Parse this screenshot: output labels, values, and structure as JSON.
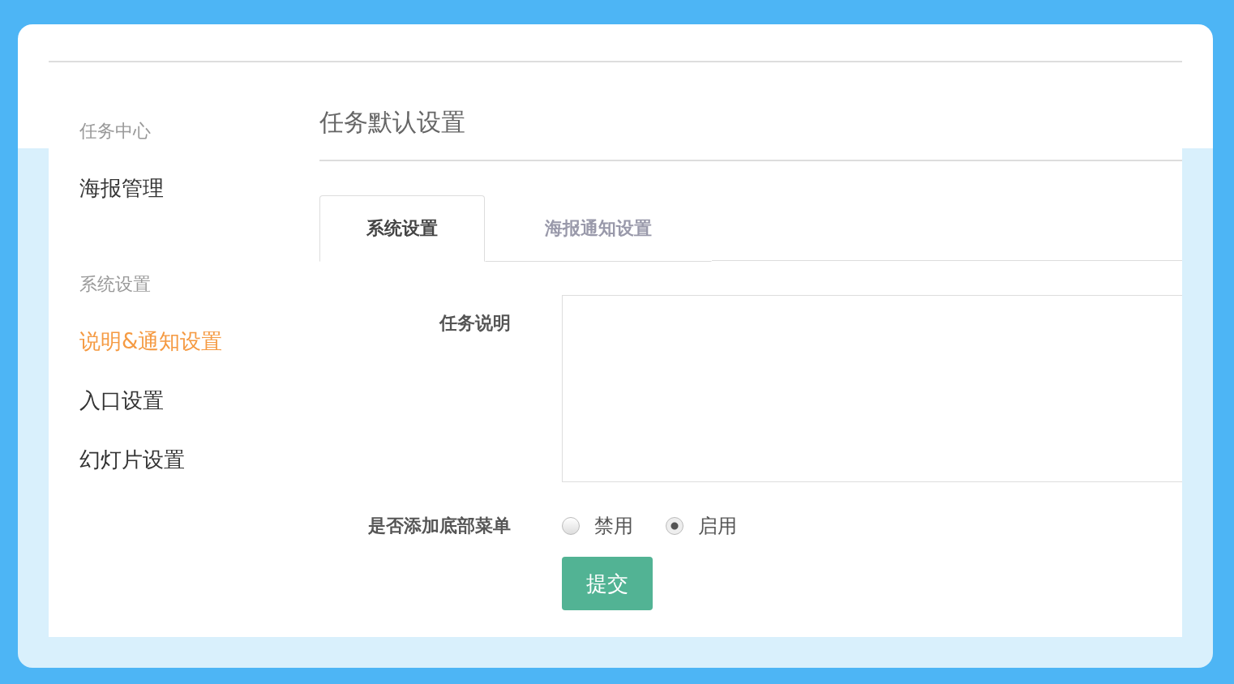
{
  "sidebar": {
    "groups": [
      {
        "title": "任务中心",
        "items": [
          {
            "label": "海报管理",
            "selected": false
          }
        ]
      },
      {
        "title": "系统设置",
        "items": [
          {
            "label": "说明&通知设置",
            "selected": true
          },
          {
            "label": "入口设置",
            "selected": false
          },
          {
            "label": "幻灯片设置",
            "selected": false
          }
        ]
      }
    ]
  },
  "page_title": "任务默认设置",
  "tabs": [
    {
      "label": "系统设置",
      "selected": true
    },
    {
      "label": "海报通知设置",
      "selected": false
    }
  ],
  "form": {
    "description": {
      "label": "任务说明"
    },
    "bottom_menu": {
      "label": "是否添加底部菜单",
      "options": [
        {
          "label": "禁用",
          "selected": false
        },
        {
          "label": "启用",
          "selected": true
        }
      ]
    },
    "submit": "提交"
  }
}
